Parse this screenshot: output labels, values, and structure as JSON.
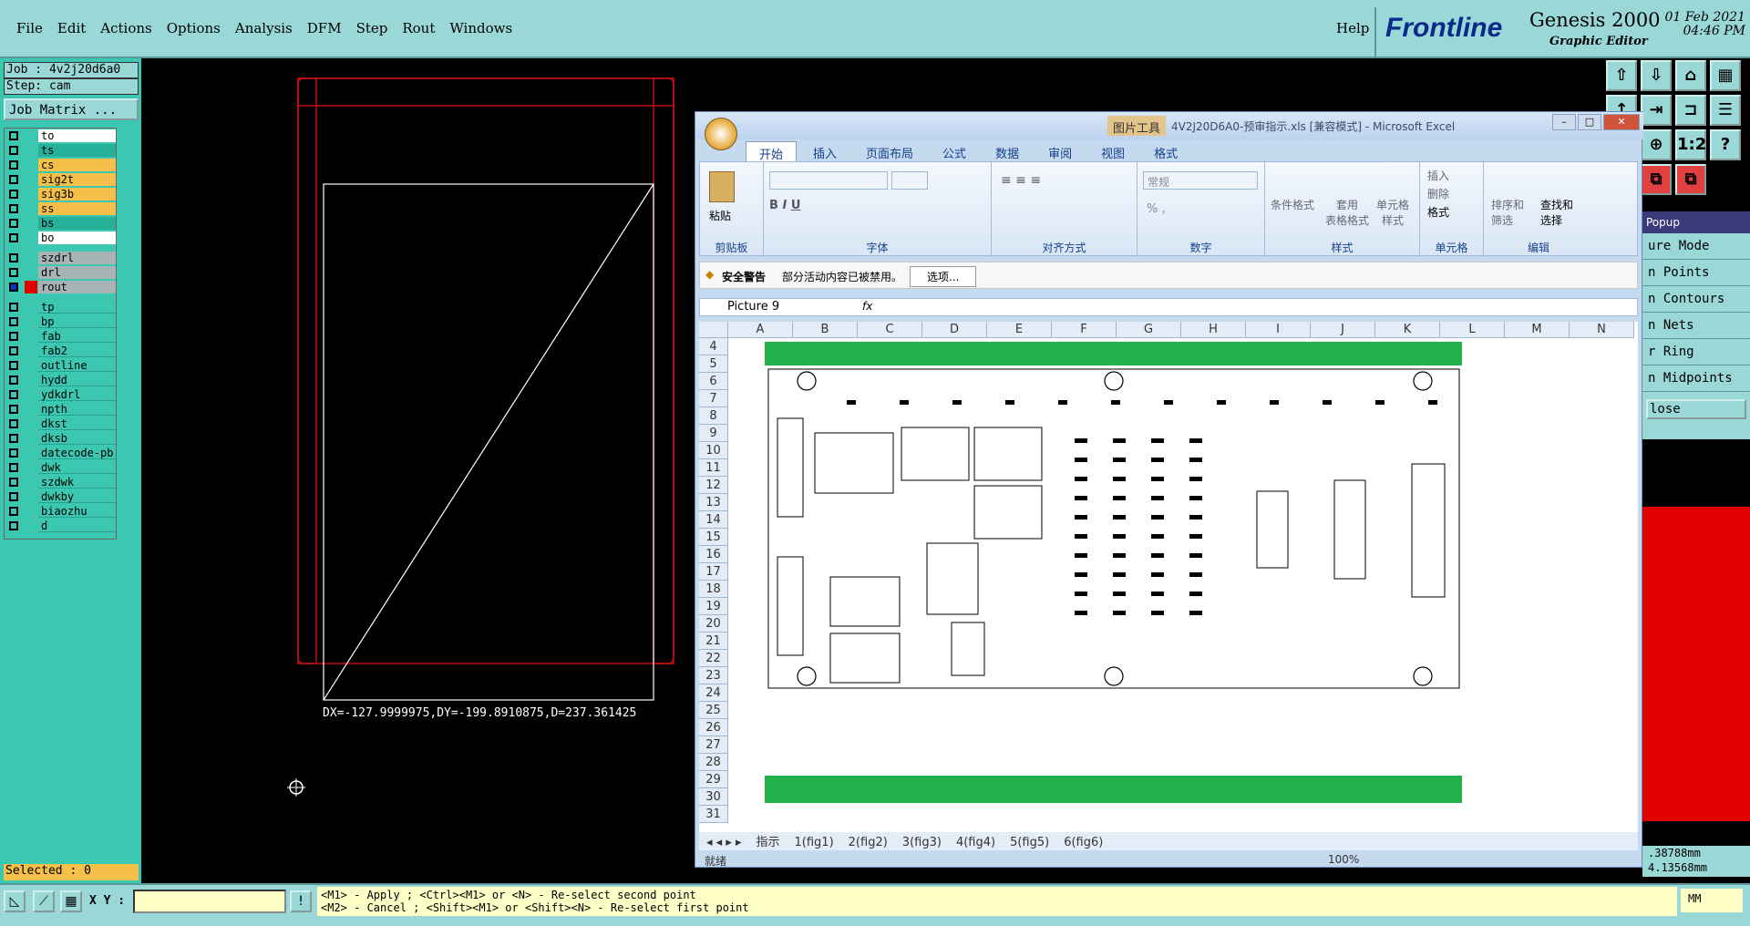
{
  "menu": [
    "File",
    "Edit",
    "Actions",
    "Options",
    "Analysis",
    "DFM",
    "Step",
    "Rout",
    "Windows"
  ],
  "help": "Help",
  "brand": {
    "logo_main": "Frontline",
    "logo_f": "F",
    "product": "Genesis 2000",
    "subtitle": "Graphic Editor",
    "date": "01 Feb 2021",
    "time": "04:46 PM"
  },
  "left": {
    "job": "Job : 4v2j20d6a0",
    "step": "Step: cam",
    "job_matrix": "Job Matrix ...",
    "layers_group1": [
      {
        "name": "to",
        "color": "#ffffff"
      },
      {
        "name": "ts",
        "color": "#26b09a"
      },
      {
        "name": "cs",
        "color": "#f5c04a"
      },
      {
        "name": "sig2t",
        "color": "#f5c04a"
      },
      {
        "name": "sig3b",
        "color": "#f5c04a"
      },
      {
        "name": "ss",
        "color": "#f5c04a"
      },
      {
        "name": "bs",
        "color": "#26b09a"
      },
      {
        "name": "bo",
        "color": "#ffffff"
      }
    ],
    "layers_group2": [
      {
        "name": "szdrl",
        "color": "#a6b4b4"
      },
      {
        "name": "drl",
        "color": "#a6b4b4"
      },
      {
        "name": "rout",
        "color": "#a6b4b4",
        "active": true
      }
    ],
    "layers_group3": [
      {
        "name": "tp"
      },
      {
        "name": "bp"
      },
      {
        "name": "fab"
      },
      {
        "name": "fab2"
      },
      {
        "name": "outline"
      },
      {
        "name": "hydd"
      },
      {
        "name": "ydkdrl"
      },
      {
        "name": "npth"
      },
      {
        "name": "dkst"
      },
      {
        "name": "dksb"
      },
      {
        "name": "datecode-pb"
      },
      {
        "name": "dwk"
      },
      {
        "name": "szdwk"
      },
      {
        "name": "dwkby"
      },
      {
        "name": "biaozhu"
      },
      {
        "name": "d"
      }
    ],
    "selected": "Selected : 0"
  },
  "canvas": {
    "measure": "DX=-127.9999975,DY=-199.8910875,D=237.361425"
  },
  "bottom": {
    "xy_label": "X Y :",
    "hint1": "<M1> - Apply  ; <Ctrl><M1> or <N> - Re-select second point",
    "hint2": "<M2> - Cancel ; <Shift><M1> or <Shift><N> - Re-select first point",
    "units": "MM"
  },
  "popup": {
    "title": "Popup",
    "items": [
      "ure Mode",
      "n Points",
      "n Contours",
      "n Nets",
      "r Ring",
      "n Midpoints"
    ],
    "close": "lose"
  },
  "coords": {
    "x": ".38788mm",
    "y": "4.13568mm"
  },
  "excel": {
    "context_tab": "图片工具",
    "title": "4V2J20D6A0-预审指示.xls  [兼容模式] - Microsoft Excel",
    "tabs": [
      "开始",
      "插入",
      "页面布局",
      "公式",
      "数据",
      "审阅",
      "视图",
      "格式"
    ],
    "groups": [
      "剪贴板",
      "字体",
      "对齐方式",
      "数字",
      "样式",
      "单元格",
      "编辑"
    ],
    "paste": "粘贴",
    "number_format": "常规",
    "style_btns": [
      "条件格式",
      "套用\n表格格式",
      "单元格\n样式"
    ],
    "cell_btns": [
      "插入",
      "删除",
      "格式"
    ],
    "edit_btns": [
      "排序和\n筛选",
      "查找和\n选择"
    ],
    "security_title": "安全警告",
    "security_msg": "部分活动内容已被禁用。",
    "options_btn": "选项...",
    "name_box": "Picture 9",
    "fx": "fx",
    "columns": [
      "A",
      "B",
      "C",
      "D",
      "E",
      "F",
      "G",
      "H",
      "I",
      "J",
      "K",
      "L",
      "M",
      "N"
    ],
    "rows": [
      "4",
      "5",
      "6",
      "7",
      "8",
      "9",
      "10",
      "11",
      "12",
      "13",
      "14",
      "15",
      "16",
      "17",
      "18",
      "19",
      "20",
      "21",
      "22",
      "23",
      "24",
      "25",
      "26",
      "27",
      "28",
      "29",
      "30",
      "31"
    ],
    "sheets": [
      "指示",
      "1(fig1)",
      "2(fig2)",
      "3(fig3)",
      "4(fig4)",
      "5(fig5)",
      "6(fig6)"
    ],
    "status": "就绪",
    "zoom": "100%"
  }
}
